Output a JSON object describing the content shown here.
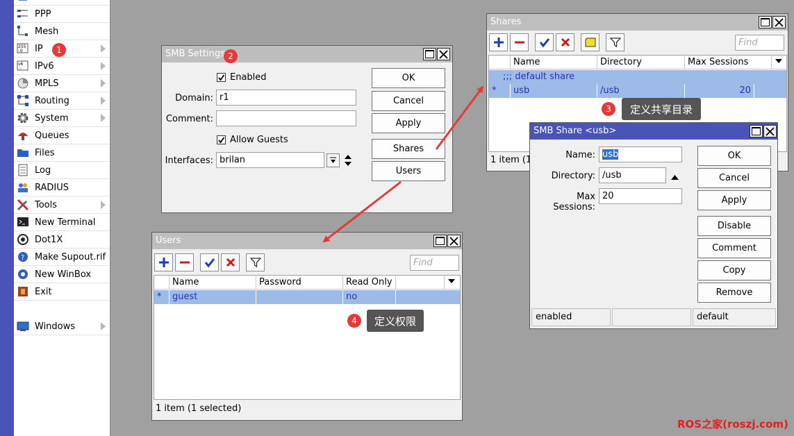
{
  "sidebar": {
    "items": [
      {
        "label": "PPP",
        "icon": "ppp-icon",
        "submenu": false
      },
      {
        "label": "Mesh",
        "icon": "mesh-icon",
        "submenu": false
      },
      {
        "label": "IP",
        "icon": "ip-icon",
        "submenu": true
      },
      {
        "label": "IPv6",
        "icon": "ipv6-icon",
        "submenu": true
      },
      {
        "label": "MPLS",
        "icon": "mpls-icon",
        "submenu": true
      },
      {
        "label": "Routing",
        "icon": "routing-icon",
        "submenu": true
      },
      {
        "label": "System",
        "icon": "system-icon",
        "submenu": true
      },
      {
        "label": "Queues",
        "icon": "queues-icon",
        "submenu": false
      },
      {
        "label": "Files",
        "icon": "files-icon",
        "submenu": false
      },
      {
        "label": "Log",
        "icon": "log-icon",
        "submenu": false
      },
      {
        "label": "RADIUS",
        "icon": "radius-icon",
        "submenu": false
      },
      {
        "label": "Tools",
        "icon": "tools-icon",
        "submenu": true
      },
      {
        "label": "New Terminal",
        "icon": "terminal-icon",
        "submenu": false
      },
      {
        "label": "Dot1X",
        "icon": "dot1x-icon",
        "submenu": false
      },
      {
        "label": "Make Supout.rif",
        "icon": "supout-icon",
        "submenu": false
      },
      {
        "label": "New WinBox",
        "icon": "winbox-icon",
        "submenu": false
      },
      {
        "label": "Exit",
        "icon": "exit-icon",
        "submenu": false
      },
      {
        "label": "Windows",
        "icon": "windows-icon",
        "submenu": true
      }
    ]
  },
  "smb_settings": {
    "title": "SMB Settings",
    "enabled_label": "Enabled",
    "enabled": true,
    "domain_label": "Domain:",
    "domain_value": "r1",
    "comment_label": "Comment:",
    "comment_value": "",
    "allow_guests_label": "Allow Guests",
    "allow_guests": true,
    "interfaces_label": "Interfaces:",
    "interfaces_value": "brilan",
    "buttons": {
      "ok": "OK",
      "cancel": "Cancel",
      "apply": "Apply",
      "shares": "Shares",
      "users": "Users"
    }
  },
  "shares": {
    "title": "Shares",
    "find_placeholder": "Find",
    "columns": [
      "Name",
      "Directory",
      "Max Sessions"
    ],
    "comment_row": ";;; default share",
    "rows": [
      {
        "flag": "*",
        "name": "usb",
        "directory": "/usb",
        "max_sessions": "20"
      }
    ],
    "status": "1 item (1 s"
  },
  "smb_share": {
    "title": "SMB Share <usb>",
    "name_label": "Name:",
    "name_value": "usb",
    "directory_label": "Directory:",
    "directory_value": "/usb",
    "max_sessions_label": "Max Sessions:",
    "max_sessions_value": "20",
    "buttons": {
      "ok": "OK",
      "cancel": "Cancel",
      "apply": "Apply",
      "disable": "Disable",
      "comment": "Comment",
      "copy": "Copy",
      "remove": "Remove"
    },
    "status": [
      "enabled",
      "",
      "default"
    ]
  },
  "users": {
    "title": "Users",
    "find_placeholder": "Find",
    "columns": [
      "Name",
      "Password",
      "Read Only"
    ],
    "rows": [
      {
        "flag": "*",
        "name": "guest",
        "password": "",
        "read_only": "no"
      }
    ],
    "status": "1 item (1 selected)"
  },
  "annotations": {
    "badges": [
      "1",
      "2",
      "3",
      "4"
    ],
    "tip3": "定义共享目录",
    "tip4": "定义权限",
    "color": "#e43a3a"
  },
  "watermark": "ROS之家(roszj.com)"
}
